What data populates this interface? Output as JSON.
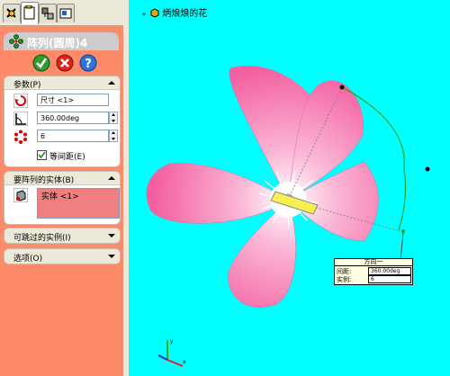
{
  "panel_tabs": [
    "feature-manager-icon",
    "property-manager-icon",
    "configuration-manager-icon",
    "display-manager-icon"
  ],
  "feature_title": "阵列(圆周)4",
  "buttons": {
    "ok": "ok-icon",
    "cancel": "cancel-icon",
    "help": "help-icon"
  },
  "parameters": {
    "title": "参数(P)",
    "axis": "尺寸 <1>",
    "angle": "360.00deg",
    "count": "6",
    "equal_spacing": "等间距(E)",
    "equal_spacing_checked": true
  },
  "bodies": {
    "title": "要阵列的实体(B)",
    "item": "实体 <1>"
  },
  "skip": {
    "title": "可跳过的实例(I)"
  },
  "options": {
    "title": "选项(O)"
  },
  "viewport": {
    "part_name": "炳烺烺的花"
  },
  "tooltip": {
    "title": "方向一",
    "spacing_label": "间距:",
    "spacing_value": "360.00deg",
    "instances_label": "实例:",
    "instances_value": "6"
  },
  "colors": {
    "panel_bg": "#fd8a6a",
    "viewport_bg": "#00ffff",
    "petal": "#f66fa8",
    "list_highlight": "#f08080"
  }
}
